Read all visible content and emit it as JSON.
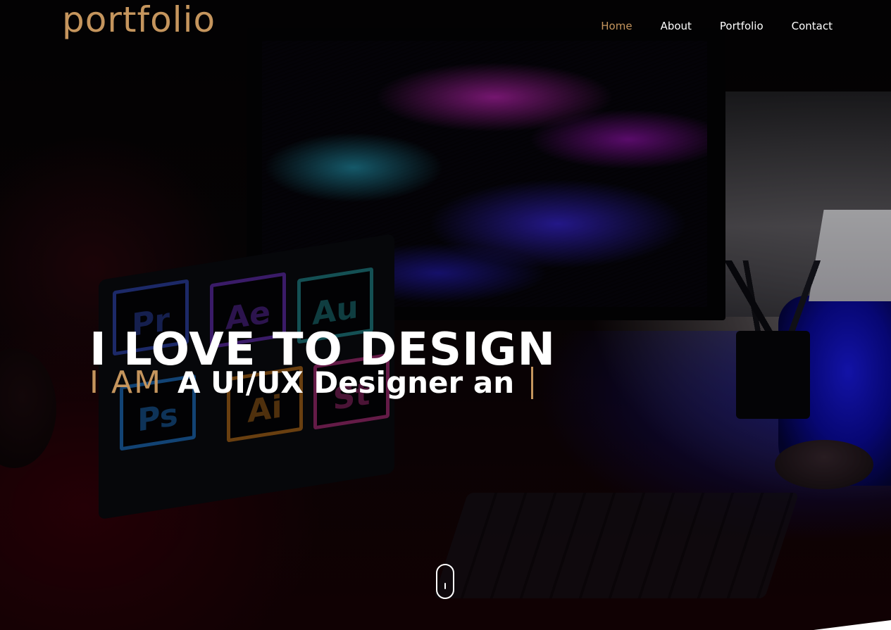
{
  "header": {
    "logo": "portfolio",
    "nav": [
      {
        "label": "Home",
        "active": true
      },
      {
        "label": "About",
        "active": false
      },
      {
        "label": "Portfolio",
        "active": false
      },
      {
        "label": "Contact",
        "active": false
      }
    ]
  },
  "hero": {
    "headline": "I LOVE TO DESIGN",
    "prefix": "I AM",
    "typed_text": "A UI/UX Designer an",
    "app_tiles": [
      "Pr",
      "Ae",
      "Au",
      "Ps",
      "Ai",
      "St"
    ]
  },
  "scroll_indicator": {
    "icon": "mouse-scroll-icon"
  },
  "colors": {
    "accent": "#c5955d",
    "text": "#ffffff",
    "background": "#000000"
  }
}
